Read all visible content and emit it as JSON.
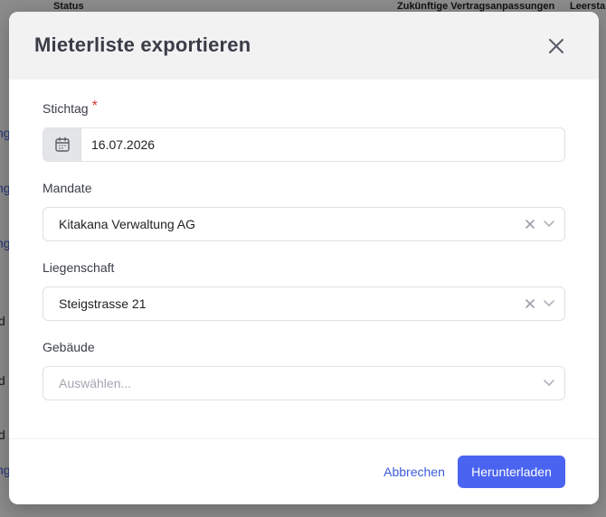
{
  "background": {
    "columns": {
      "status": "Status",
      "future_adjustments": "Zukünftige Vertragsanpassungen",
      "vacancy": "Leersta"
    },
    "row_fragments": [
      "ng",
      "ng",
      "ng",
      "d",
      "d",
      "d",
      "ng"
    ]
  },
  "modal": {
    "title": "Mieterliste exportieren",
    "close_icon": "close-icon",
    "fields": {
      "stichtag": {
        "label": "Stichtag",
        "required_mark": "*",
        "value": "16.07.2026",
        "icon": "calendar-icon"
      },
      "mandate": {
        "label": "Mandate",
        "value": "Kitakana Verwaltung AG"
      },
      "liegenschaft": {
        "label": "Liegenschaft",
        "value": "Steigstrasse 21"
      },
      "gebaeude": {
        "label": "Gebäude",
        "placeholder": "Auswählen..."
      }
    },
    "footer": {
      "cancel_label": "Abbrechen",
      "download_label": "Herunterladen"
    }
  },
  "colors": {
    "accent": "#4a63f0",
    "link": "#3b5bdb",
    "required": "#d93a3a",
    "header_bg": "#f2f2f3"
  }
}
